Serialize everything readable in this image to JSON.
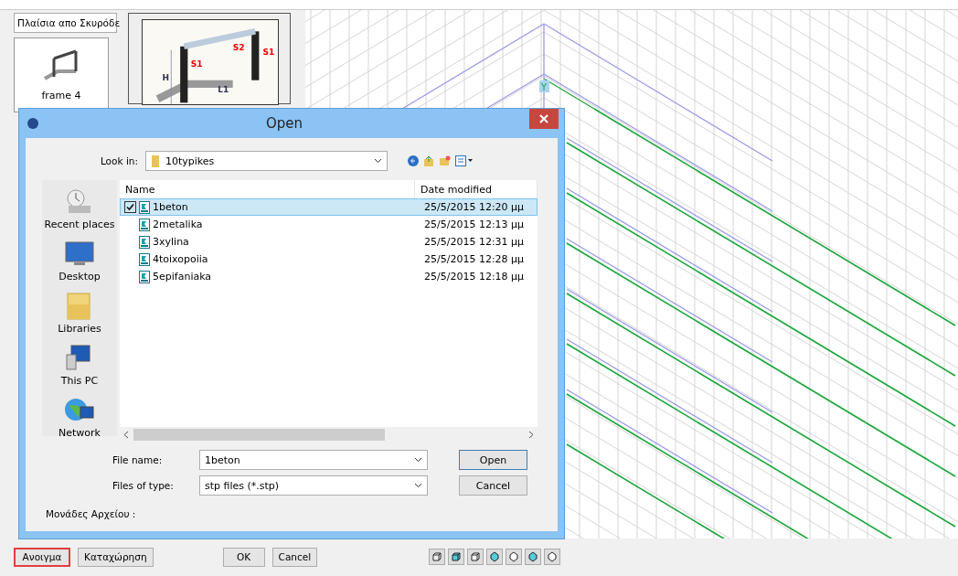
{
  "category_dropdown": {
    "value": "Πλαίσια απο Σκυρόδε"
  },
  "thumbnails": [
    {
      "label": "frame  4",
      "selected": true
    }
  ],
  "preview": {
    "labels": [
      "S1",
      "S2",
      "S1",
      "H",
      "L1"
    ]
  },
  "viewport": {
    "axis_label": "Y"
  },
  "dialog": {
    "title": "Open",
    "look_in": {
      "label": "Look in:",
      "value": "10typikes"
    },
    "places": [
      {
        "label": "Recent places",
        "kind": "recent"
      },
      {
        "label": "Desktop",
        "kind": "desktop"
      },
      {
        "label": "Libraries",
        "kind": "libraries"
      },
      {
        "label": "This PC",
        "kind": "pc"
      },
      {
        "label": "Network",
        "kind": "network"
      }
    ],
    "columns": [
      "Name",
      "Date modified"
    ],
    "files": [
      {
        "name": "1beton",
        "date": "25/5/2015 12:20 μμ",
        "selected": true,
        "checked": true
      },
      {
        "name": "2metalika",
        "date": "25/5/2015 12:13 μμ",
        "selected": false,
        "checked": false
      },
      {
        "name": "3xylina",
        "date": "25/5/2015 12:31 μμ",
        "selected": false,
        "checked": false
      },
      {
        "name": "4toixopoiia",
        "date": "25/5/2015 12:28 μμ",
        "selected": false,
        "checked": false
      },
      {
        "name": "5epifaniaka",
        "date": "25/5/2015 12:18 μμ",
        "selected": false,
        "checked": false
      }
    ],
    "file_name": {
      "label": "File name:",
      "value": "1beton"
    },
    "file_type": {
      "label": "Files of type:",
      "value": "stp files (*.stp)"
    },
    "buttons": [
      "Open",
      "Cancel"
    ],
    "units_label": "Μονάδες Αρχείου :"
  },
  "bottom_bar": {
    "file_buttons": [
      {
        "label": "Ανοιγμα",
        "focused": true
      },
      {
        "label": "Καταχώρηση",
        "focused": false
      }
    ],
    "dialog_buttons": [
      "OK",
      "Cancel"
    ]
  }
}
